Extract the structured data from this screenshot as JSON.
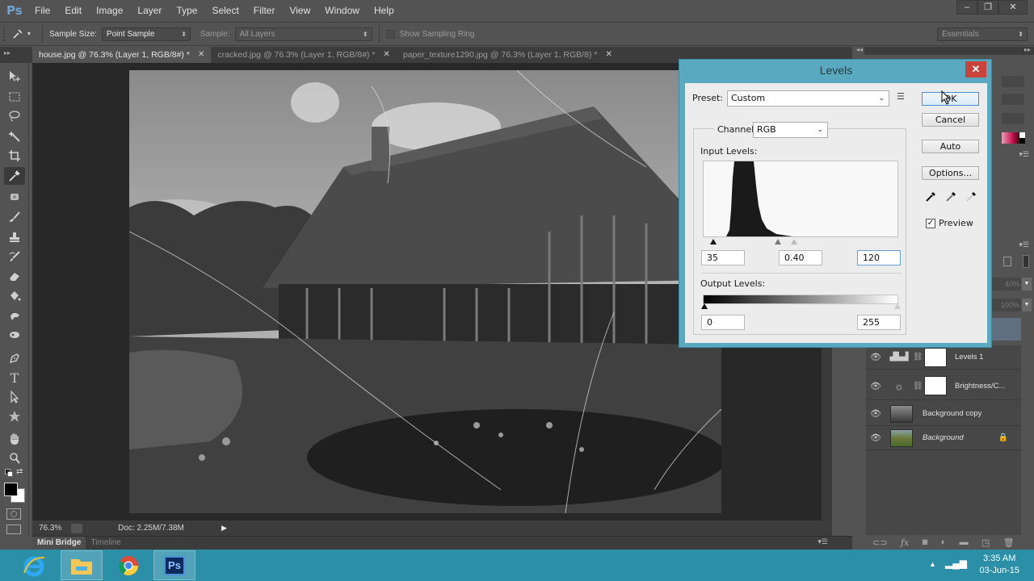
{
  "app": {
    "logo": "Ps",
    "menu": [
      "File",
      "Edit",
      "Image",
      "Layer",
      "Type",
      "Select",
      "Filter",
      "View",
      "Window",
      "Help"
    ],
    "window_controls": {
      "minimize": "–",
      "restore": "❐",
      "close": "✕"
    }
  },
  "options_bar": {
    "tool_icon": "eyedropper-icon",
    "sample_size_label": "Sample Size:",
    "sample_size_value": "Point Sample",
    "sample_label": "Sample:",
    "sample_value": "All Layers",
    "show_sampling_ring_label": "Show Sampling Ring",
    "show_sampling_ring_checked": false,
    "workspace": "Essentials"
  },
  "doc_tabs": [
    {
      "label": "house.jpg @ 76.3% (Layer 1, RGB/8#) *",
      "active": true
    },
    {
      "label": "cracked.jpg @ 76.3% (Layer 1, RGB/8#) *",
      "active": false
    },
    {
      "label": "paper_texture1290.jpg @ 76.3% (Layer 1, RGB/8) *",
      "active": false
    }
  ],
  "status": {
    "zoom": "76.3%",
    "doc_size": "Doc: 2.25M/7.38M"
  },
  "bottom_tabs": [
    "Mini Bridge",
    "Timeline"
  ],
  "tools": [
    "move-tool",
    "marquee-tool",
    "lasso-tool",
    "magic-wand-tool",
    "crop-tool",
    "eyedropper-tool",
    "spot-healing-tool",
    "brush-tool",
    "clone-stamp-tool",
    "history-brush-tool",
    "eraser-tool",
    "paint-bucket-tool",
    "smudge-tool",
    "dodge-tool",
    "pen-tool",
    "type-tool",
    "path-selection-tool",
    "custom-shape-tool",
    "hand-tool",
    "zoom-tool"
  ],
  "colors": {
    "foreground": "#000000",
    "background": "#ffffff",
    "dialog_frame": "#59aac0",
    "close_red": "#c9433a",
    "taskbar": "#2c8fa8"
  },
  "levels_dialog": {
    "title": "Levels",
    "preset_label": "Preset:",
    "preset_value": "Custom",
    "channel_label": "Channel:",
    "channel_value": "RGB",
    "input_levels_label": "Input Levels:",
    "input_black": "35",
    "input_gamma": "0.40",
    "input_white": "120",
    "output_levels_label": "Output Levels:",
    "output_black": "0",
    "output_white": "255",
    "buttons": {
      "ok": "OK",
      "cancel": "Cancel",
      "auto": "Auto",
      "options": "Options..."
    },
    "preview_label": "Preview",
    "preview_checked": true,
    "close": "✕"
  },
  "layers_panel": {
    "opacity_partial": "40%",
    "fill_partial": "100%",
    "layers": [
      {
        "name": "Levels 1",
        "type": "adjustment",
        "icon": "levels-adjustment-icon",
        "visible": true,
        "italic": false
      },
      {
        "name": "Brightness/C...",
        "type": "adjustment",
        "icon": "brightness-contrast-icon",
        "visible": true,
        "italic": false
      },
      {
        "name": "Background copy",
        "type": "image",
        "visible": true,
        "italic": false
      },
      {
        "name": "Background",
        "type": "image",
        "visible": true,
        "italic": true,
        "locked": true
      }
    ],
    "footer_icons": [
      "link-layers-icon",
      "fx-icon",
      "add-mask-icon",
      "adjustment-layer-icon",
      "group-folder-icon",
      "new-layer-icon",
      "trash-icon"
    ]
  },
  "taskbar": {
    "apps": [
      "internet-explorer",
      "file-explorer",
      "chrome",
      "photoshop"
    ],
    "photoshop_label": "Ps",
    "time": "3:35 AM",
    "date": "03-Jun-15"
  }
}
